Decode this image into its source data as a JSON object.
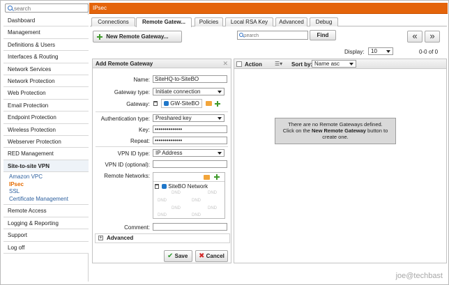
{
  "sidebar": {
    "search_placeholder": "search",
    "items": [
      "Dashboard",
      "Management",
      "Definitions & Users",
      "Interfaces & Routing",
      "Network Services",
      "Network Protection",
      "Web Protection",
      "Email Protection",
      "Endpoint Protection",
      "Wireless Protection",
      "Webserver Protection",
      "RED Management"
    ],
    "group": "Site-to-site VPN",
    "sub_items": [
      "Amazon VPC",
      "IPsec",
      "SSL",
      "Certificate Management"
    ],
    "active_sub": "IPsec",
    "items_after": [
      "Remote Access",
      "Logging & Reporting",
      "Support",
      "Log off"
    ]
  },
  "header": {
    "title": "IPsec",
    "color": "#e4640b"
  },
  "tabs": [
    "Connections",
    "Remote Gatew...",
    "Policies",
    "Local RSA Key",
    "Advanced",
    "Debug"
  ],
  "active_tab": "Remote Gatew...",
  "toolbar": {
    "new_button": "New Remote Gateway...",
    "search_placeholder": "search",
    "find_button": "Find",
    "prev": "«",
    "next": "»",
    "display_label": "Display:",
    "display_value": "10",
    "range": "0-0 of 0"
  },
  "form": {
    "title": "Add Remote Gateway",
    "name_label": "Name:",
    "name_value": "SiteHQ-to-SiteBO",
    "gateway_type_label": "Gateway type:",
    "gateway_type_value": "Initiate connection",
    "gateway_label": "Gateway:",
    "gateway_value": "GW-SiteBO",
    "auth_type_label": "Authentication type:",
    "auth_type_value": "Preshared key",
    "key_label": "Key:",
    "key_value": "••••••••••••••",
    "repeat_label": "Repeat:",
    "repeat_value": "••••••••••••••",
    "vpn_id_type_label": "VPN ID type:",
    "vpn_id_type_value": "IP Address",
    "vpn_id_label": "VPN ID (optional):",
    "vpn_id_value": "",
    "remote_networks_label": "Remote Networks:",
    "remote_network_item": "SiteBO Network",
    "dnd": "DND",
    "comment_label": "Comment:",
    "comment_value": "",
    "advanced": "Advanced",
    "advanced_toggle": "+",
    "save": "Save",
    "cancel": "Cancel"
  },
  "list": {
    "action_header": "Action",
    "sort_label": "Sort by:",
    "sort_value": "Name asc",
    "empty_line1": "There are no Remote Gateways defined.",
    "empty_line2_pre": "Click on the ",
    "empty_line2_bold": "New Remote Gateway",
    "empty_line2_post": " button to",
    "empty_line3": "create one."
  },
  "watermark": "joe@techbast"
}
